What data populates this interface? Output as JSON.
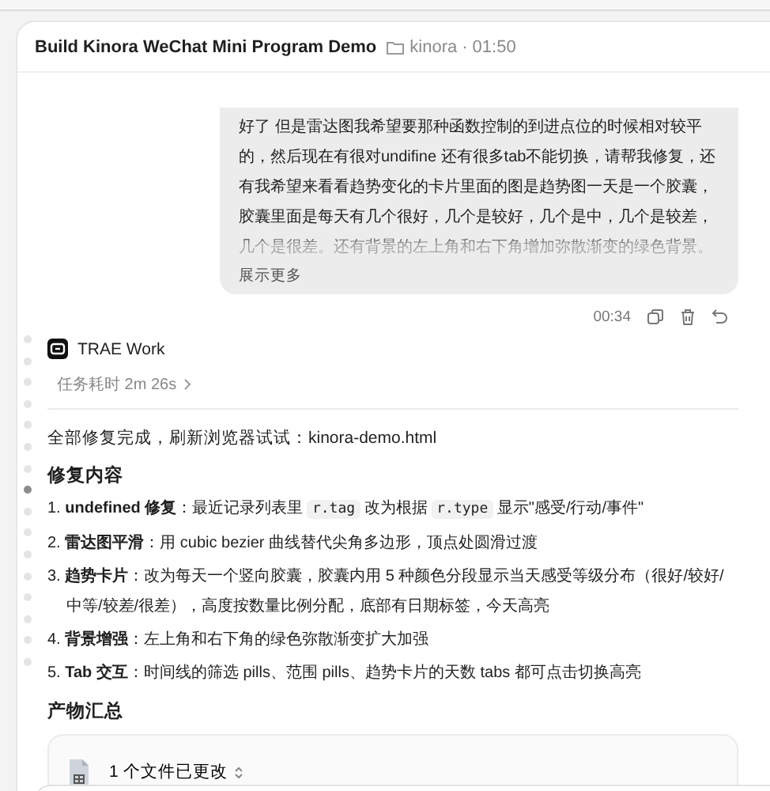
{
  "header": {
    "title": "Build Kinora WeChat Mini Program Demo",
    "folder": "kinora",
    "separator": "·",
    "time": "01:50"
  },
  "user_message": {
    "text": "好了 但是雷达图我希望要那种函数控制的到进点位的时候相对较平的，然后现在有很对undifine 还有很多tab不能切换，请帮我修复，还有我希望来看看趋势变化的卡片里面的图是趋势图一天是一个胶囊，胶囊里面是每天有几个很好，几个是较好，几个是中，几个是较差，几个是很差。还有背景的左上角和右下角增加弥散渐变的绿色背景。",
    "expanded": false,
    "more_label": "展示更多",
    "time": "00:34"
  },
  "timeline_dots": [
    {
      "selected": false
    },
    {
      "selected": false
    },
    {
      "selected": false
    },
    {
      "selected": false
    },
    {
      "selected": false
    },
    {
      "selected": false
    },
    {
      "selected": false
    },
    {
      "selected": true
    },
    {
      "selected": false
    },
    {
      "selected": false
    },
    {
      "selected": false
    },
    {
      "selected": false
    },
    {
      "selected": false
    },
    {
      "selected": false
    },
    {
      "selected": false
    },
    {
      "selected": false
    }
  ],
  "agent": {
    "name": "TRAE Work",
    "duration": "任务耗时 2m 26s",
    "summary": "全部修复完成，刷新浏览器试试：kinora-demo.html",
    "section_title": "修复内容",
    "items": [
      {
        "number": "1.",
        "lead": "undefined 修复",
        "parts": [
          {
            "kind": "text",
            "text": "：最近记录列表里 "
          },
          {
            "kind": "code",
            "text": "r.tag"
          },
          {
            "kind": "text",
            "text": " 改为根据 "
          },
          {
            "kind": "code",
            "text": "r.type"
          },
          {
            "kind": "text",
            "text": " 显示\"感受/行动/事件\""
          }
        ]
      },
      {
        "number": "2.",
        "lead": "雷达图平滑",
        "parts": [
          {
            "kind": "text",
            "text": "：用 cubic bezier 曲线替代尖角多边形，顶点处圆滑过渡"
          }
        ]
      },
      {
        "number": "3.",
        "lead": "趋势卡片",
        "parts": [
          {
            "kind": "text",
            "text": "：改为每天一个竖向胶囊，胶囊内用 5 种颜色分段显示当天感受等级分布（很好/较好/中等/较差/很差），高度按数量比例分配，底部有日期标签，今天高亮"
          }
        ]
      },
      {
        "number": "4.",
        "lead": "背景增强",
        "parts": [
          {
            "kind": "text",
            "text": "：左上角和右下角的绿色弥散渐变扩大加强"
          }
        ]
      },
      {
        "number": "5.",
        "lead": "Tab 交互",
        "parts": [
          {
            "kind": "text",
            "text": "：时间线的筛选 pills、范围 pills、趋势卡片的天数 tabs 都可点击切换高亮"
          }
        ]
      }
    ],
    "artifacts_title": "产物汇总",
    "file_card": {
      "label": "1 个文件已更改"
    }
  }
}
